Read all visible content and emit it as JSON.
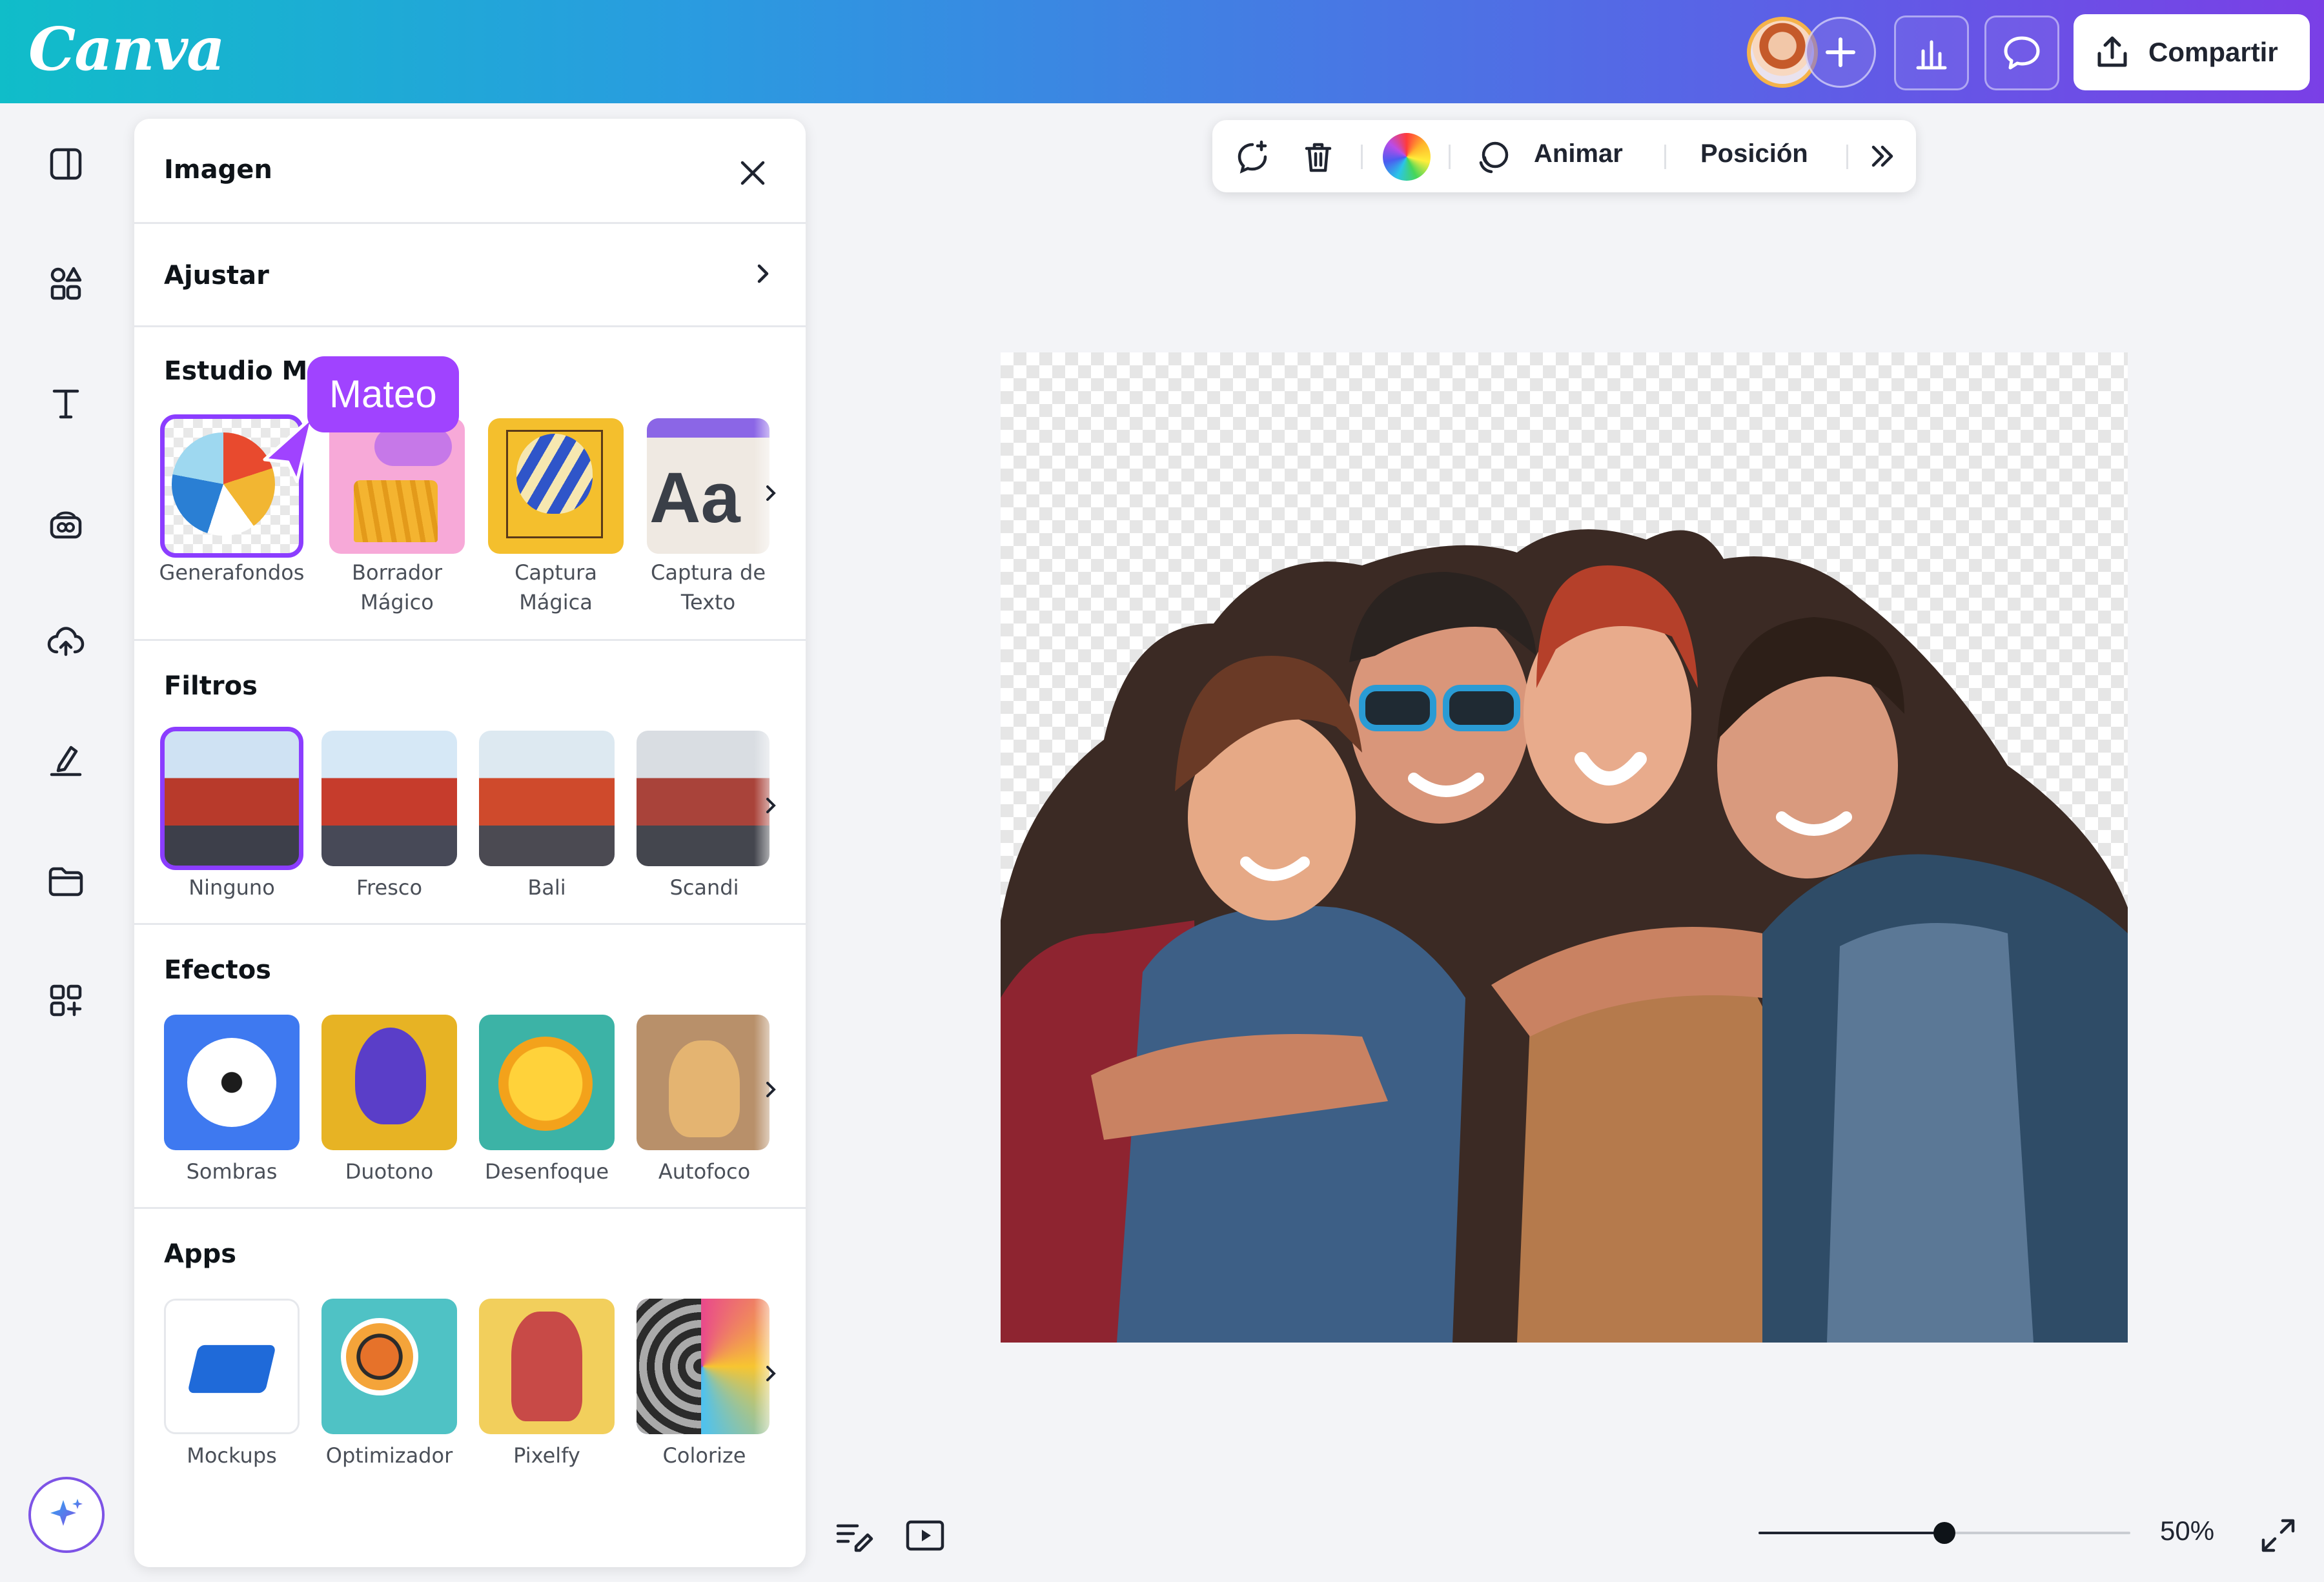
{
  "app": {
    "logo_text": "Canva",
    "brand_color": "#8b3dff"
  },
  "header": {
    "share_label": "Compartir",
    "icons": [
      "user-avatar",
      "plus-icon",
      "analytics-icon",
      "comment-icon",
      "share-icon"
    ]
  },
  "rail": {
    "icons": [
      "design-icon",
      "elements-icon",
      "text-icon",
      "brand-icon",
      "uploads-icon",
      "draw-icon",
      "projects-icon",
      "apps-icon",
      "magic-sparkle-icon"
    ]
  },
  "panel": {
    "title": "Imagen",
    "adjust_label": "Ajustar",
    "sections": {
      "magic_studio": {
        "title": "Estudio Mágico",
        "items": [
          "Generafondos",
          "Borrador Mágico",
          "Captura Mágica",
          "Captura de Texto"
        ],
        "selected_index": 0
      },
      "filters": {
        "title": "Filtros",
        "items": [
          "Ninguno",
          "Fresco",
          "Bali",
          "Scandi"
        ],
        "selected_index": 0
      },
      "effects": {
        "title": "Efectos",
        "items": [
          "Sombras",
          "Duotono",
          "Desenfoque",
          "Autofoco"
        ]
      },
      "apps": {
        "title": "Apps",
        "items": [
          "Mockups",
          "Optimizador",
          "Pixelfy",
          "Colorize"
        ]
      }
    }
  },
  "collaborator_cursor": {
    "name": "Mateo",
    "color": "#a043ff"
  },
  "toolbar": {
    "animate_label": "Animar",
    "position_label": "Posición",
    "icons": [
      "regenerate-icon",
      "trash-icon",
      "color-wheel-icon",
      "animate-icon",
      "more-chevrons-icon"
    ]
  },
  "canvas": {
    "content": "group-photo-background-removed"
  },
  "footer": {
    "zoom_label": "50%",
    "zoom_fraction": 0.5,
    "icons": [
      "notes-icon",
      "present-icon",
      "fullscreen-icon"
    ]
  }
}
